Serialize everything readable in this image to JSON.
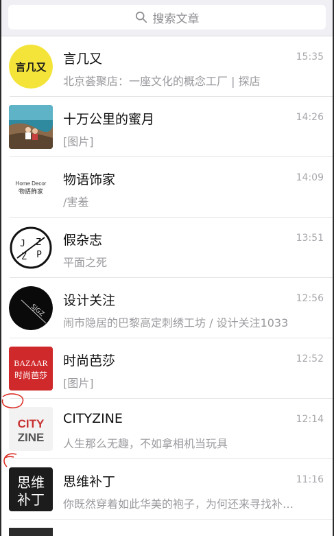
{
  "search": {
    "placeholder": "搜索文章"
  },
  "articles": [
    {
      "title": "言几又",
      "time": "15:35",
      "preview": "北京荟聚店：一座文化的概念工厂 | 探店",
      "avatar_text": "言几又",
      "avatar_bg": "#f4e43a"
    },
    {
      "title": "十万公里的蜜月",
      "time": "14:26",
      "preview": "[图片]"
    },
    {
      "title": "物语饰家",
      "time": "14:09",
      "preview": "/害羞",
      "avatar_line1": "Home Decor",
      "avatar_line2": "物語飾家"
    },
    {
      "title": "假杂志",
      "time": "13:51",
      "preview": "平面之死",
      "avatar_letters": [
        "J",
        "Z",
        "Z",
        "P"
      ]
    },
    {
      "title": "设计关注",
      "time": "12:56",
      "preview": "闹市隐居的巴黎高定刺绣工坊 / 设计关注1033",
      "avatar_text": "SJGZ"
    },
    {
      "title": "时尚芭莎",
      "time": "12:52",
      "preview": "[图片]",
      "avatar_line1": "BAZAAR",
      "avatar_line2": "时尚芭莎",
      "avatar_bg": "#d0292b"
    },
    {
      "title": "CITYZINE",
      "time": "12:14",
      "preview": "人生那么无趣，不如拿相机当玩具",
      "avatar_line1": "CITY",
      "avatar_line2": "ZINE"
    },
    {
      "title": "思维补丁",
      "time": "11:16",
      "preview": "你既然穿着如此华美的袍子，为何还来寻找补…",
      "avatar_line1": "思维",
      "avatar_line2": "补丁",
      "avatar_bg": "#1c1c1c"
    }
  ],
  "colors": {
    "accent_red": "#d9261c",
    "search_bg": "#efeff4"
  }
}
